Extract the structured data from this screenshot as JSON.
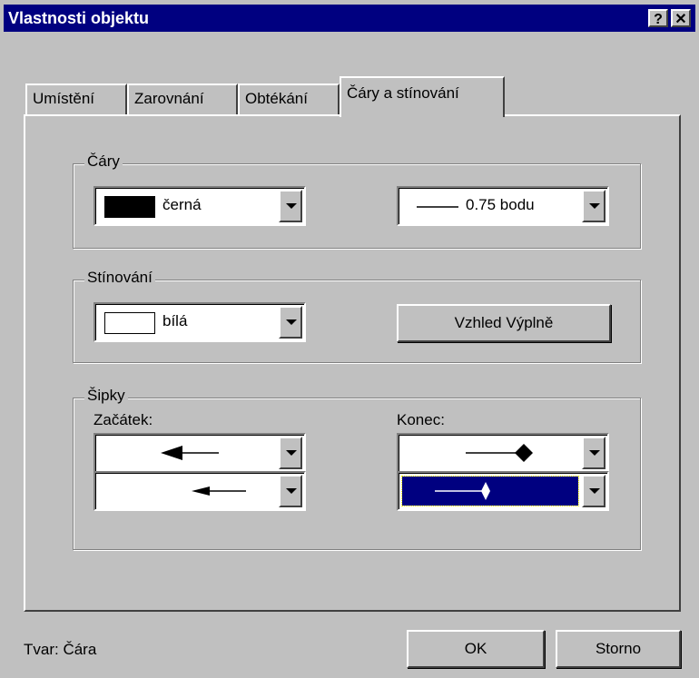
{
  "window": {
    "title": "Vlastnosti objektu",
    "help_label": "?",
    "close_label": "✕"
  },
  "tabs": [
    {
      "label": "Umístění",
      "active": false
    },
    {
      "label": "Zarovnání",
      "active": false
    },
    {
      "label": "Obtékání",
      "active": false
    },
    {
      "label": "Čáry a stínování",
      "active": true
    }
  ],
  "lines_group": {
    "legend": "Čáry",
    "color_value": "černá",
    "color_hex": "#000000",
    "weight_value": "0.75 bodu"
  },
  "shading_group": {
    "legend": "Stínování",
    "color_value": "bílá",
    "color_hex": "#ffffff",
    "fill_button_label": "Vzhled Výplně"
  },
  "arrows_group": {
    "legend": "Šipky",
    "start_label": "Začátek:",
    "end_label": "Konec:",
    "start_style_icon": "arrow-left-large-icon",
    "start_size_icon": "arrow-left-small-icon",
    "end_style_icon": "diamond-end-icon",
    "end_size_icon": "diamond-end-selected-icon"
  },
  "footer": {
    "shape_text": "Tvar: Čára",
    "ok_label": "OK",
    "cancel_label": "Storno"
  },
  "colors": {
    "titlebar": "#000080",
    "face": "#c0c0c0",
    "selection": "#000080"
  }
}
